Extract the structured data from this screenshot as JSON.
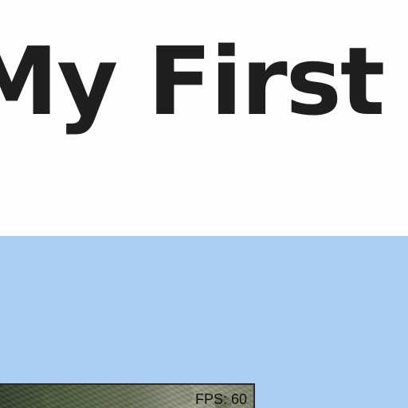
{
  "page": {
    "title": "My First Pr"
  },
  "game": {
    "fps_text": "FPS: 60"
  },
  "colors": {
    "background": "#fdfdfd",
    "title_text": "#1f1f1f",
    "sky_panel": "#abcdf2",
    "viewport_border": "#2b2b2b"
  }
}
